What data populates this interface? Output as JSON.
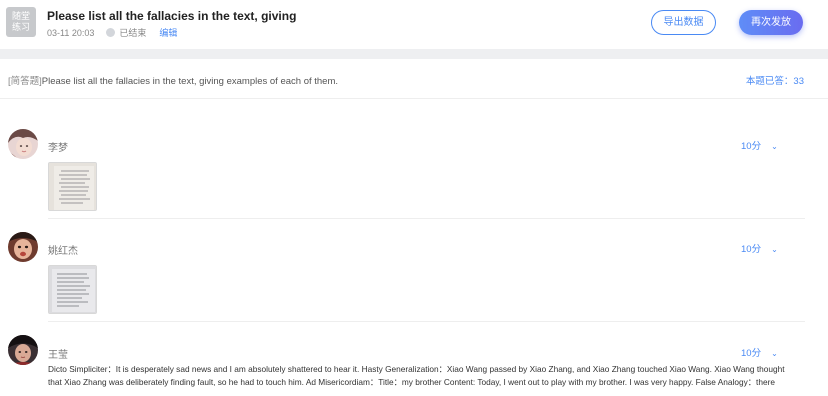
{
  "header": {
    "badge": [
      "随堂",
      "练习"
    ],
    "title": "Please list all the fallacies in the text, giving",
    "date": "03-11 20:03",
    "status": "已结束",
    "edit": "编辑",
    "export_button": "导出数据",
    "resend_button": "再次发放"
  },
  "question": {
    "type_tag": "[简答题]",
    "text": "Please list all the fallacies in the text, giving examples of each of them.",
    "answered_count": "本题已答：33"
  },
  "answers": [
    {
      "name": "李梦",
      "score": "10分"
    },
    {
      "name": "姚红杰",
      "score": "10分"
    },
    {
      "name": "王莹",
      "score": "10分",
      "text_line1": "Dicto Simpliciter：It is desperately sad news and I am absolutely shattered to hear it. Hasty Generalization：Xiao Wang passed by Xiao Zhang, and Xiao Zhang touched Xiao Wang. Xiao Wang thought",
      "text_line2": "that Xiao Zhang was deliberately finding fault, so he had to touch him. Ad Misericordiam：Title：my brother Content: Today, I went out to play with my brother. I was very happy. False Analogy：there"
    }
  ],
  "colors": {
    "accent": "#4a8af4",
    "button_gradient_start": "#5f8df7",
    "button_gradient_end": "#6a6cf0"
  },
  "icons": [
    "status-dot-icon",
    "chevron-down-icon"
  ]
}
